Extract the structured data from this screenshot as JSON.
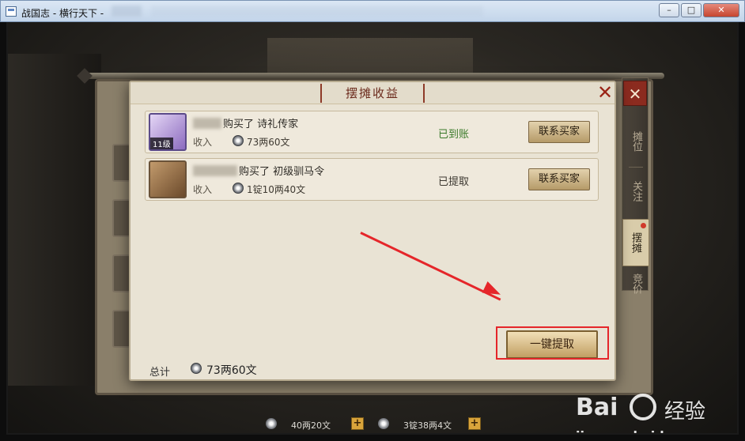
{
  "window": {
    "title": "战国志 - 横行天下 - ",
    "minimize": "–",
    "maximize": "□",
    "close": "✕"
  },
  "side_tabs": [
    {
      "label": "摊位",
      "active": false
    },
    {
      "label": "关注",
      "active": false
    },
    {
      "label": "摆摊",
      "active": true,
      "badge": true
    },
    {
      "label": "竞价",
      "active": false
    }
  ],
  "side_close": "✕",
  "dialog": {
    "title": "摆摊收益",
    "close": "✕",
    "rows": [
      {
        "icon": "scroll-icon",
        "level": "11级",
        "bought_text": "购买了 诗礼传家",
        "income_label": "收入",
        "amount": "73两60文",
        "status": "已到账",
        "status_color": "#3a7a2a",
        "contact_label": "联系买家"
      },
      {
        "icon": "saddle-icon",
        "bought_text": "购买了 初级驯马令",
        "income_label": "收入",
        "amount": "1锭10两40文",
        "status": "已提取",
        "status_color": "#3c3830",
        "contact_label": "联系买家"
      }
    ],
    "total_label": "总计",
    "total_amount": "73两60文",
    "collect_label": "一键提取"
  },
  "currency_bar": {
    "silver": "40两20文",
    "gold": "3锭38两4文",
    "plus": "+"
  },
  "watermark": {
    "logo": "Bai",
    "cn": "经验",
    "url": "jingyan.baidu.com"
  },
  "colors": {
    "highlight": "#e5262a",
    "accent": "#8b2b1f"
  }
}
